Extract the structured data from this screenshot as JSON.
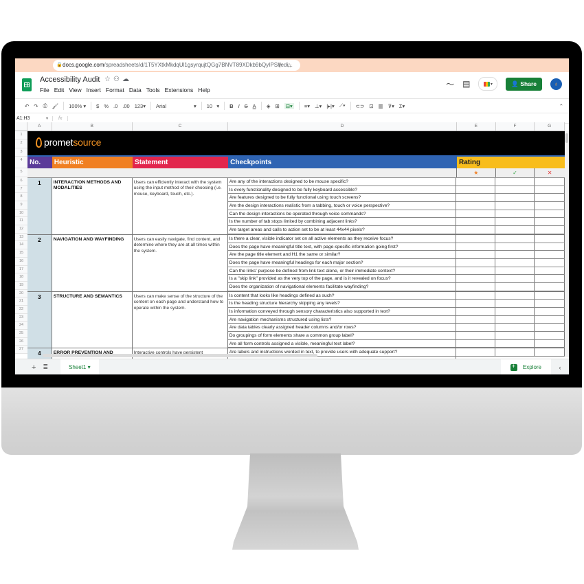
{
  "browser": {
    "url_domain": "docs.google.com",
    "url_path": "/spreadsheets/d/1T5YXtkMkdqUl1gsyrqujtQGg7BNVT89XDkb9bQyIPSI/edi...",
    "share_icon": "share-page-icon",
    "bookmark_icon": "star-icon"
  },
  "app": {
    "title": "Accessibility Audit",
    "title_icons": [
      "star-icon",
      "move-folder-icon",
      "cloud-status-icon"
    ],
    "menus": [
      "File",
      "Edit",
      "View",
      "Insert",
      "Format",
      "Data",
      "Tools",
      "Extensions",
      "Help"
    ],
    "share_label": "Share",
    "avatar_glyph": "♁"
  },
  "toolbar": {
    "zoom": "100%",
    "currency": "$",
    "percent": "%",
    "dec_less": ".0",
    "dec_more": ".00",
    "format": "123",
    "font": "Arial",
    "font_size": "10",
    "bold": "B",
    "italic": "I",
    "strike": "S",
    "text_color": "A",
    "sum": "Σ"
  },
  "formula_bar": {
    "name_box": "A1:H3",
    "fx": "fx",
    "value": ""
  },
  "columns": [
    "A",
    "B",
    "C",
    "D",
    "E",
    "F",
    "G"
  ],
  "rows": [
    "1",
    "2",
    "3",
    "4",
    "5",
    "6",
    "7",
    "8",
    "9",
    "10",
    "11",
    "12",
    "13",
    "14",
    "15",
    "16",
    "17",
    "18",
    "19",
    "20",
    "21",
    "22",
    "23",
    "24",
    "25",
    "26",
    "27"
  ],
  "brand": {
    "part1": "promet",
    "part2": "source",
    "accent": "#f39323"
  },
  "headers": {
    "no": "No.",
    "heuristic": "Heuristic",
    "statement": "Statement",
    "checkpoints": "Checkpoints",
    "rating": "Rating",
    "colors": {
      "no": "#5b3a99",
      "heuristic": "#f07f22",
      "statement": "#e2264d",
      "checkpoints": "#2f64b3",
      "rating": "#f8bd1c"
    }
  },
  "rating_symbols": [
    {
      "glyph": "★",
      "color": "#f07f22",
      "meaning": "star"
    },
    {
      "glyph": "✓",
      "color": "#3aa84a",
      "meaning": "pass"
    },
    {
      "glyph": "✕",
      "color": "#e23b3b",
      "meaning": "fail"
    }
  ],
  "heuristics": [
    {
      "no": "1",
      "name": "INTERACTION METHODS AND MODALITIES",
      "statement": "Users can efficiently interact with the system using the input method of their choosing (i.e. mouse, keyboard, touch, etc.).",
      "checkpoints": [
        "Are any of the interactions designed to be mouse specific?",
        "Is every functionality designed to be fully keyboard accessible?",
        "Are features designed to be fully functional using touch screens?",
        "Are the design interactions realistic from a tabbing, touch or voice perspective?",
        "Can the design interactions be operated through voice commands?",
        "Is the number of tab stops limited by combining adjacent links?",
        "Are target areas and calls to action set to be at least 44x44 pixels?"
      ]
    },
    {
      "no": "2",
      "name": "NAVIGATION AND WAYFINDING",
      "statement": "Users can easily navigate, find content, and determine where they are at all times within the system.",
      "checkpoints": [
        "Is there a clear, visible indicator set on all active elements as they receive focus?",
        "Does the page have meaningful title text, with page-specific information going first?",
        "Are the page title element and H1 the same or similar?",
        "Does the page have meaningful headings for each major section?",
        "Can the links' purpose be defined from link text alone, or their immediate context?",
        "Is a \"skip link\" provided as the very top of the page, and is it revealed on focus?",
        "Does the organization of navigational elements facilitate wayfinding?"
      ]
    },
    {
      "no": "3",
      "name": "STRUCTURE AND SEMANTICS",
      "statement": "Users can make sense of the structure of the content on each page and understand how to operate within the system.",
      "checkpoints": [
        "Is content that looks like headings defined as such?",
        "Is the heading structure hierarchy skipping any levels?",
        "Is information conveyed through sensory characteristics also supported in text?",
        "Are navigation mechanisms structured using lists?",
        "Are data tables clearly assigned header columns and/or rows?",
        "Do groupings of form elements share a common group label?",
        "Are all form controls assigned a visible, meaningful text label?"
      ]
    },
    {
      "no": "4",
      "name": "ERROR PREVENTION AND",
      "statement": "Interactive controls have persistent",
      "checkpoints": [
        "Are labels and instructions worded in text, to provide users with adequate support?"
      ]
    }
  ],
  "tabs": {
    "sheet": "Sheet1",
    "explore": "Explore"
  }
}
